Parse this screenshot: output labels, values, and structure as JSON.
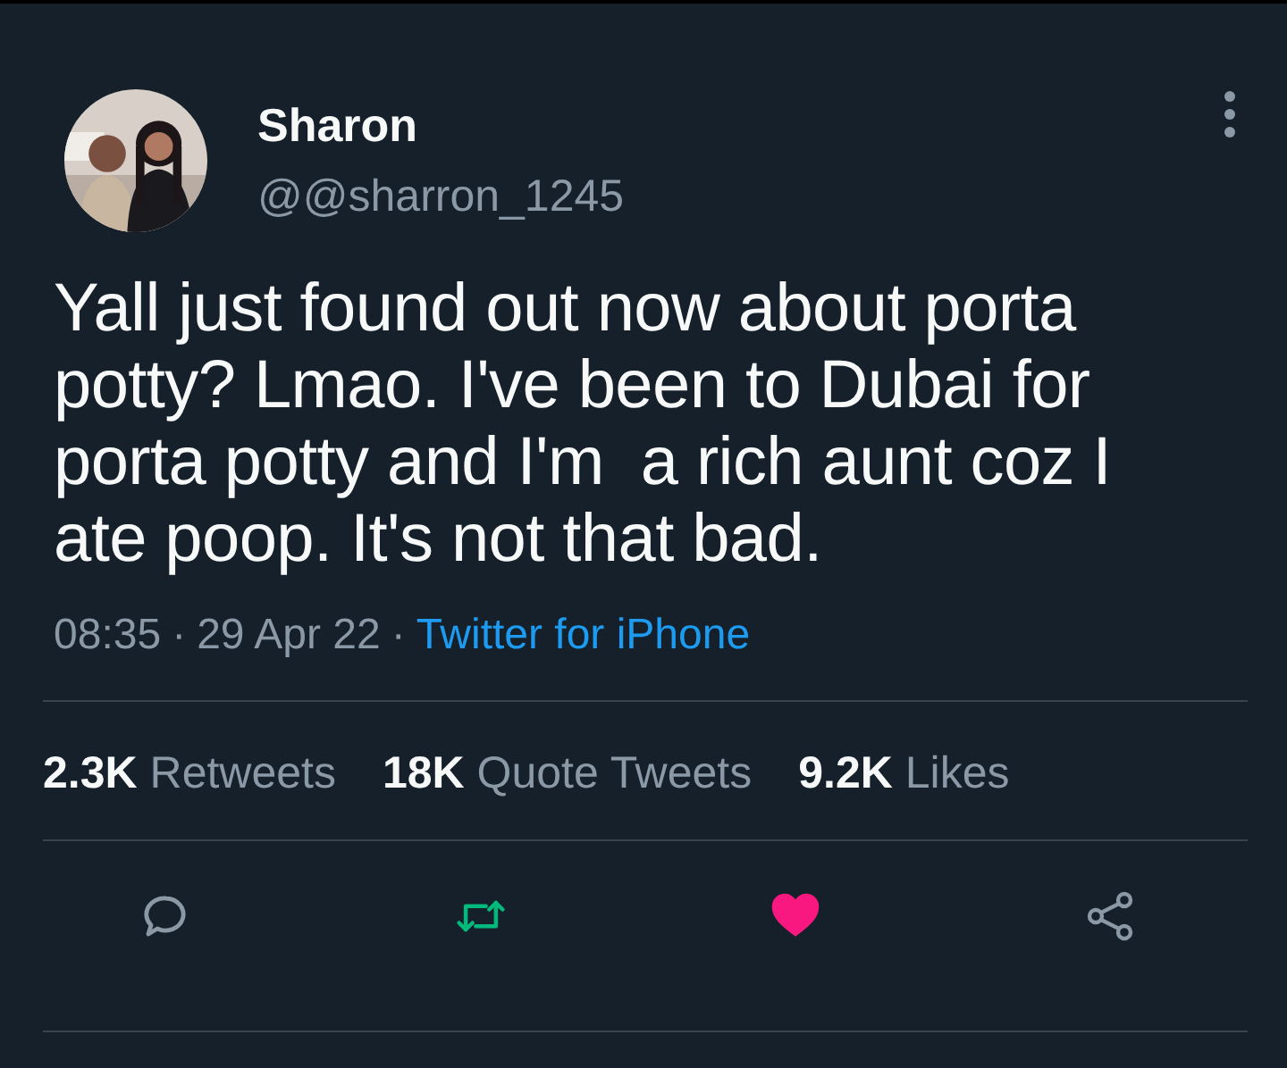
{
  "author": {
    "name": "Sharon",
    "handle": "@@sharron_1245"
  },
  "text": "Yall just found out now about porta potty? Lmao. I've been to Dubai for porta potty and I'm  a rich aunt coz I ate poop. It's not that bad.",
  "meta": {
    "time": "08:35",
    "separator_1": "·",
    "date": "29 Apr 22",
    "separator_2": "·",
    "source": "Twitter for iPhone"
  },
  "stats": [
    {
      "count": "2.3K",
      "label": "Retweets"
    },
    {
      "count": "18K",
      "label": "Quote Tweets"
    },
    {
      "count": "9.2K",
      "label": "Likes"
    }
  ],
  "actions": {
    "retweeted": true,
    "liked": true
  }
}
